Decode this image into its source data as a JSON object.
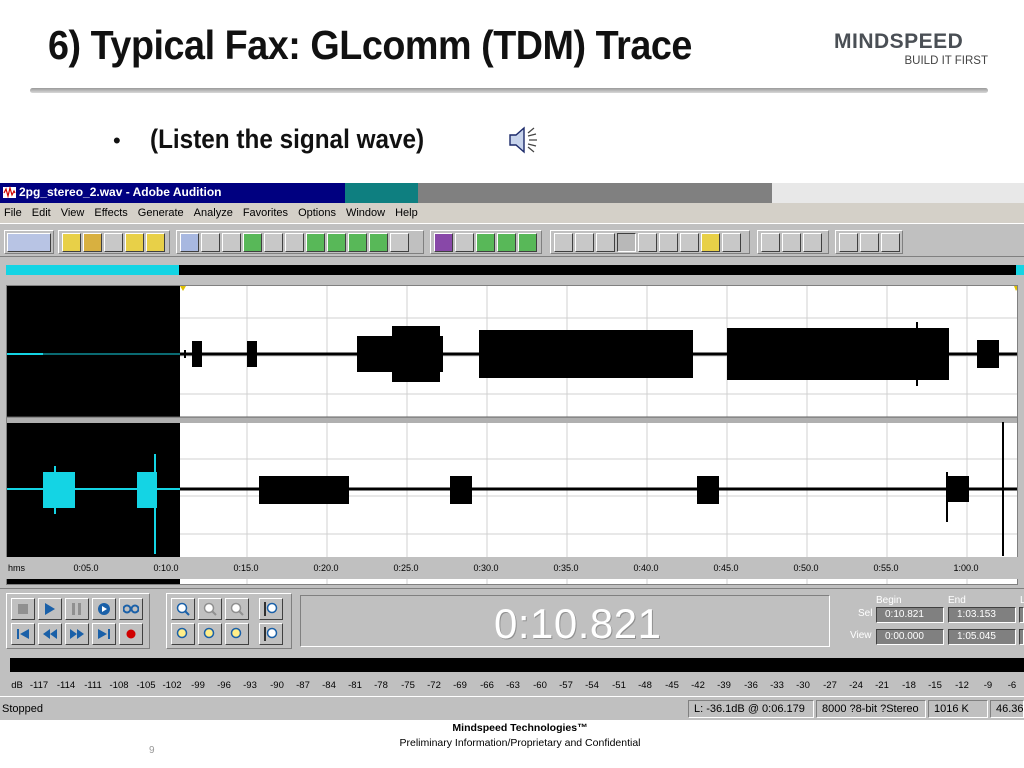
{
  "slide": {
    "title": "6) Typical Fax: GLcomm (TDM) Trace",
    "bullet": "(Listen the signal wave)",
    "logo": {
      "name": "MINDSPEED",
      "tagline": "BUILD IT FIRST"
    },
    "footer_company": "Mindspeed Technologies™",
    "footer_notice": "Preliminary Information/Proprietary and Confidential",
    "page_number": "9"
  },
  "app": {
    "window_title": "2pg_stereo_2.wav - Adobe Audition",
    "menu": [
      "File",
      "Edit",
      "View",
      "Effects",
      "Generate",
      "Analyze",
      "Favorites",
      "Options",
      "Window",
      "Help"
    ],
    "time_ruler": {
      "units_label": "hms",
      "ticks": [
        "0:05.0",
        "0:10.0",
        "0:15.0",
        "0:20.0",
        "0:25.0",
        "0:30.0",
        "0:35.0",
        "0:40.0",
        "0:45.0",
        "0:50.0",
        "0:55.0",
        "1:00.0"
      ]
    },
    "current_time": "0:10.821",
    "selection": {
      "begin_header": "Begin",
      "end_header": "End",
      "length_header": "L",
      "sel_label": "Sel",
      "view_label": "View",
      "sel_begin": "0:10.821",
      "sel_end": "1:03.153",
      "view_begin": "0:00.000",
      "view_end": "1:05.045"
    },
    "level_meter": {
      "db_label": "dB",
      "ticks": [
        "-117",
        "-114",
        "-111",
        "-108",
        "-105",
        "-102",
        "-99",
        "-96",
        "-93",
        "-90",
        "-87",
        "-84",
        "-81",
        "-78",
        "-75",
        "-72",
        "-69",
        "-66",
        "-63",
        "-60",
        "-57",
        "-54",
        "-51",
        "-48",
        "-45",
        "-42",
        "-39",
        "-36",
        "-33",
        "-30",
        "-27",
        "-24",
        "-21",
        "-18",
        "-15",
        "-12",
        "-9",
        "-6"
      ]
    },
    "status": {
      "state": "Stopped",
      "level_readout": "L: -36.1dB @  0:06.179",
      "format": "8000 ?8-bit ?Stereo",
      "size": "1016 K",
      "free": "46.36"
    },
    "colors": {
      "waveform": "#000000",
      "selection_fill": "#000000",
      "unselected_wave": "#14d4e4",
      "title_bar": "#000080"
    }
  }
}
